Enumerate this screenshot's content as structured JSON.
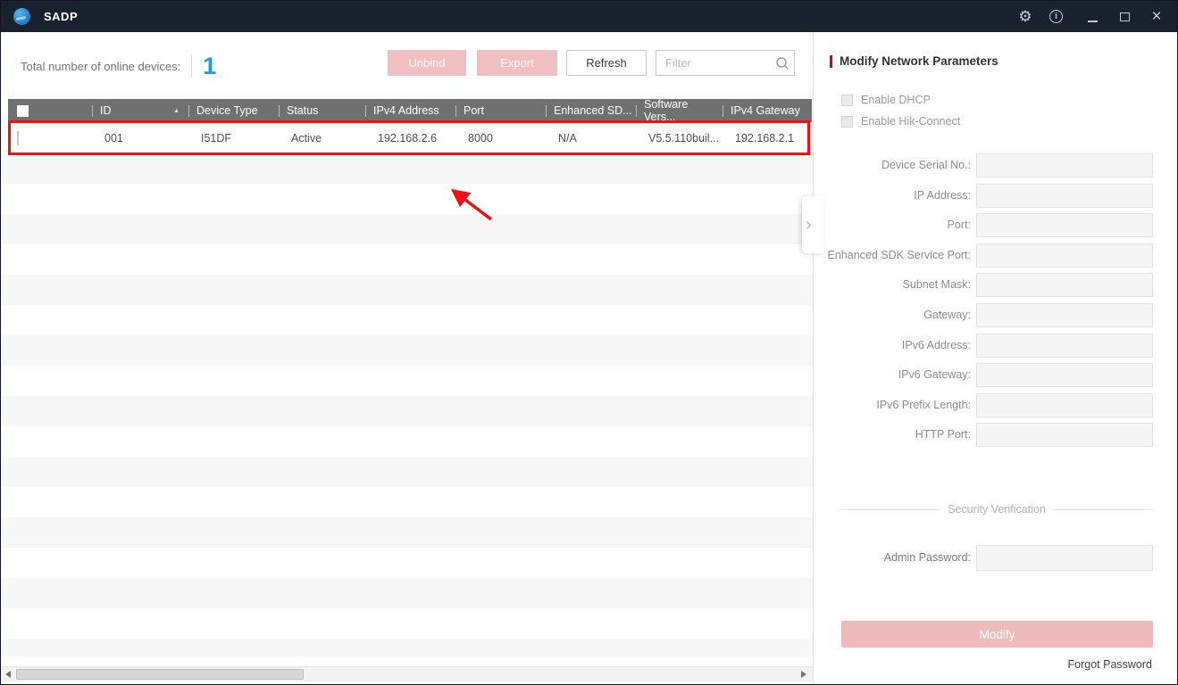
{
  "titlebar": {
    "app_title": "SADP"
  },
  "icons": {
    "gear": "⚙",
    "info": "i",
    "close": "×",
    "chevron_right": "›",
    "sort_asc": "▲"
  },
  "toolbar": {
    "total_label": "Total number of online devices:",
    "total_count": "1",
    "unbind_label": "Unbind",
    "export_label": "Export",
    "refresh_label": "Refresh",
    "filter_placeholder": "Filter"
  },
  "table": {
    "columns": [
      "ID",
      "Device Type",
      "Status",
      "IPv4 Address",
      "Port",
      "Enhanced SD...",
      "Software Vers...",
      "IPv4 Gateway"
    ],
    "rows": [
      {
        "id": "001",
        "device_type": "I51DF",
        "status": "Active",
        "ipv4_address": "192.168.2.6",
        "port": "8000",
        "enhanced_sdk_service_port": "N/A",
        "software_version": "V5.5.110buil...",
        "ipv4_gateway": "192.168.2.1"
      }
    ]
  },
  "panel": {
    "title": "Modify Network Parameters",
    "enable_dhcp_label": "Enable DHCP",
    "enable_hik_connect_label": "Enable Hik-Connect",
    "fields": [
      "Device Serial No.:",
      "IP Address:",
      "Port:",
      "Enhanced SDK Service Port:",
      "Subnet Mask:",
      "Gateway:",
      "IPv6 Address:",
      "IPv6 Gateway:",
      "IPv6 Prefix Length:",
      "HTTP Port:"
    ],
    "security_divider_label": "Security Verification",
    "admin_password_label": "Admin Password:",
    "modify_label": "Modify",
    "forgot_password_label": "Forgot Password"
  },
  "colors": {
    "titlebar_bg": "#19212e",
    "accent_blue": "#1e9be9",
    "accent_red": "#e60000",
    "annotation_red": "#f50f0f",
    "disabled_pink": "#f0bfbf",
    "table_header_gray": "#707070"
  }
}
